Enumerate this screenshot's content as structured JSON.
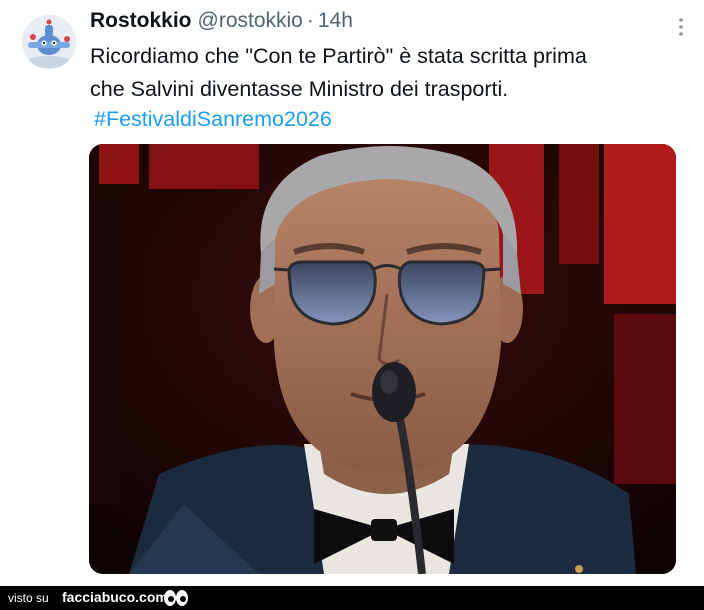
{
  "tweet": {
    "author": {
      "name": "Rostokkio",
      "handle": "@rostokkio",
      "separator": "·",
      "time": "14h",
      "avatar_icon": "airplane-cartoon-avatar"
    },
    "text_lines": [
      "Ricordiamo che \"Con te Partirò\" è stata scritta prima",
      "che Salvini diventasse Ministro dei trasporti."
    ],
    "hashtag": "#FestivaldiSanremo2026",
    "media": {
      "kind": "photo",
      "subject": "singer-with-sunglasses-at-microphone"
    },
    "more_icon": "more-vertical-icon"
  },
  "footer": {
    "prefix": "visto su",
    "site": "facciabuco.com",
    "logo_icon": "eyes-logo-icon"
  },
  "colors": {
    "text": "#0f1419",
    "secondary": "#536471",
    "link": "#1d9bf0",
    "footer_bg": "#000000"
  }
}
